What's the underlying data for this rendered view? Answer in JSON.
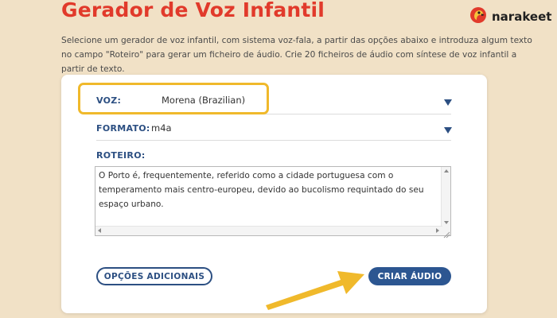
{
  "header": {
    "title": "Gerador de Voz Infantil",
    "brand_name": "narakeet"
  },
  "intro": {
    "text": "Selecione um gerador de voz infantil, com sistema voz-fala, a partir das opções abaixo e introduza algum texto no campo \"Roteiro\" para gerar um ficheiro de áudio. Crie 20 ficheiros de áudio com síntese de voz infantil a partir de texto."
  },
  "form": {
    "voice": {
      "label": "VOZ:",
      "value": "Morena (Brazilian)"
    },
    "format": {
      "label": "FORMATO:",
      "value": "m4a"
    },
    "script": {
      "label": "ROTEIRO:",
      "text": "O Porto é, frequentemente, referido como a cidade portuguesa com o temperamento mais centro-europeu, devido ao bucolismo requintado do seu espaço urbano."
    },
    "more_options_label": "OPÇÕES ADICIONAIS",
    "create_audio_label": "CRIAR ÁUDIO"
  },
  "colors": {
    "title_red": "#e13a2b",
    "label_blue": "#2c4f82",
    "button_blue": "#2c5691",
    "highlight_yellow": "#f0b92b",
    "background": "#f1e1c6"
  }
}
